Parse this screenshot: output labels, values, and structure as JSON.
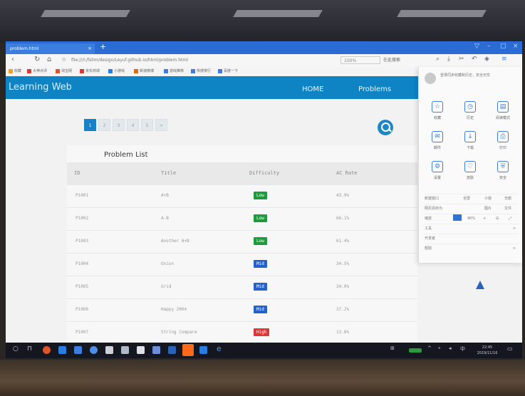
{
  "browser": {
    "tab_title": "problem.html",
    "tab_close": "×",
    "tab_add": "+",
    "window_controls": [
      "▽",
      "–",
      "□",
      "×"
    ],
    "url": "file:///I:/fslim/design/Leyuf.github.io/html/problem.html",
    "zoom": "100%",
    "search_placeholder": "在此搜索",
    "bookmarks": [
      "收藏",
      "大神点评",
      "淘宝网",
      "京东商城",
      "小游戏",
      "新浪微博",
      "游戏推荐",
      "热搜排行",
      "百度一下"
    ]
  },
  "page": {
    "logo": "Learning Web",
    "nav": [
      "HOME",
      "Problems"
    ],
    "pager": [
      "1",
      "2",
      "3",
      "4",
      "5",
      ">"
    ],
    "panel_title": "Problem List",
    "columns": [
      "ID",
      "Title",
      "Difficulty",
      "AC Rate"
    ],
    "rows": [
      {
        "id": "P1001",
        "title": "A+B",
        "difficulty": "Low",
        "ac": "43.9%"
      },
      {
        "id": "P1002",
        "title": "A-B",
        "difficulty": "Low",
        "ac": "66.1%"
      },
      {
        "id": "P1003",
        "title": "Another A+B",
        "difficulty": "Low",
        "ac": "61.4%"
      },
      {
        "id": "P1004",
        "title": "Union",
        "difficulty": "Mid",
        "ac": "34.5%"
      },
      {
        "id": "P1005",
        "title": "Grid",
        "difficulty": "Mid",
        "ac": "34.0%"
      },
      {
        "id": "P1006",
        "title": "Happy 2004",
        "difficulty": "Mid",
        "ac": "37.2%"
      },
      {
        "id": "P1007",
        "title": "String Compare",
        "difficulty": "High",
        "ac": "13.6%"
      }
    ]
  },
  "menu": {
    "login_hint": "登录同步收藏和历史，安全无忧",
    "grid": [
      {
        "icon": "☆",
        "label": "收藏"
      },
      {
        "icon": "◷",
        "label": "历史"
      },
      {
        "icon": "▤",
        "label": "阅读模式"
      },
      {
        "icon": "✉",
        "label": "邮件"
      },
      {
        "icon": "↓",
        "label": "下载"
      },
      {
        "icon": "⎙",
        "label": "打印"
      },
      {
        "icon": "⚙",
        "label": "设置"
      },
      {
        "icon": "♡",
        "label": "皮肤"
      },
      {
        "icon": "⛨",
        "label": "安全"
      }
    ],
    "rows": [
      {
        "label": "新建窗口",
        "values": [
          "全屏",
          "小窗",
          "无痕"
        ]
      },
      {
        "label": "网页另存为",
        "values": [
          "图片",
          "文件"
        ]
      },
      {
        "label": "缩放",
        "values": [
          "90%",
          "+",
          "⊟",
          "⤢"
        ]
      },
      {
        "label": "工具",
        "values": [
          ">"
        ]
      },
      {
        "label": "开发者",
        "values": [
          ""
        ]
      },
      {
        "label": "帮助",
        "values": [
          ">"
        ]
      }
    ]
  },
  "taskbar": {
    "time": "22:45",
    "date": "2019/11/16"
  },
  "colors": {
    "accent": "#0e84c4",
    "low": "#1e9a3c",
    "mid": "#2561c9",
    "high": "#d83a3a"
  }
}
